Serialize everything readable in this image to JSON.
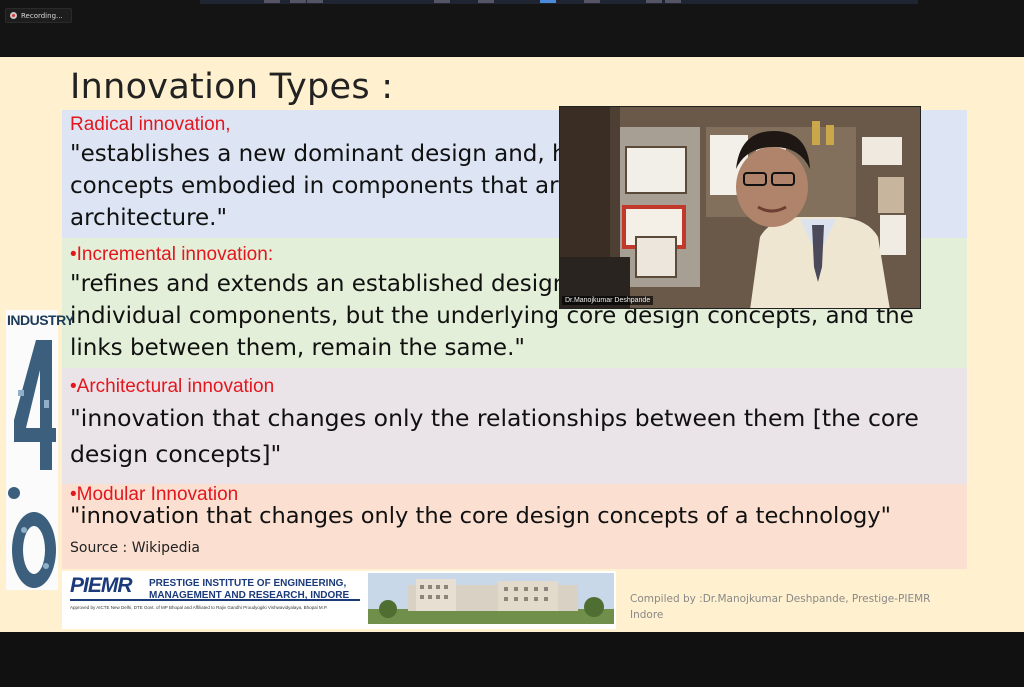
{
  "toolbar": {
    "recording_label": "Recording..."
  },
  "slide": {
    "title": "Innovation Types :",
    "sections": [
      {
        "label": "Radical innovation,",
        "quote": "\"establishes a new dominant design and, hence, a new set of core design concepts embodied in components that are linked together in a new architecture.\""
      },
      {
        "label": "•Incremental innovation:",
        "quote": "\"refines and extends an established design. Improvement occurs in individual components, but the underlying core design concepts, and the links between them, remain the same.\""
      },
      {
        "label": "•Architectural innovation",
        "quote": "\"innovation that changes only the relationships between them [the core design concepts]\""
      },
      {
        "label": "•Modular Innovation",
        "quote": "\"innovation that changes only the core design concepts of a technology\""
      }
    ],
    "source": "Source : Wikipedia",
    "industry_text": "INDUSTRY",
    "logo": {
      "acronym": "PIEMR",
      "institute_line1": "PRESTIGE INSTITUTE OF ENGINEERING,",
      "institute_line2": "MANAGEMENT AND RESEARCH, INDORE",
      "approval": "Approved by AICTE New Delhi, DTE Govt. of MP Bhopal and Affiliated to Rajiv Gandhi Proudyogiki Vishwavidyalaya, Bhopal M.P."
    },
    "compiled_by": "Compiled by :Dr.Manojkumar Deshpande, Prestige-PIEMR Indore"
  },
  "video": {
    "participant_name": "Dr.Manojkumar Deshpande"
  },
  "colors": {
    "label_red": "#e3161d",
    "band_blue": "#dde5f4",
    "band_green": "#e3efd8",
    "band_mauve": "#eae3e8",
    "band_peach": "#fbdfd0",
    "slide_bg": "#fff1cf"
  },
  "icons": {
    "recording": "recording-icon",
    "industry_graphic": "industry-4-0-icon"
  }
}
